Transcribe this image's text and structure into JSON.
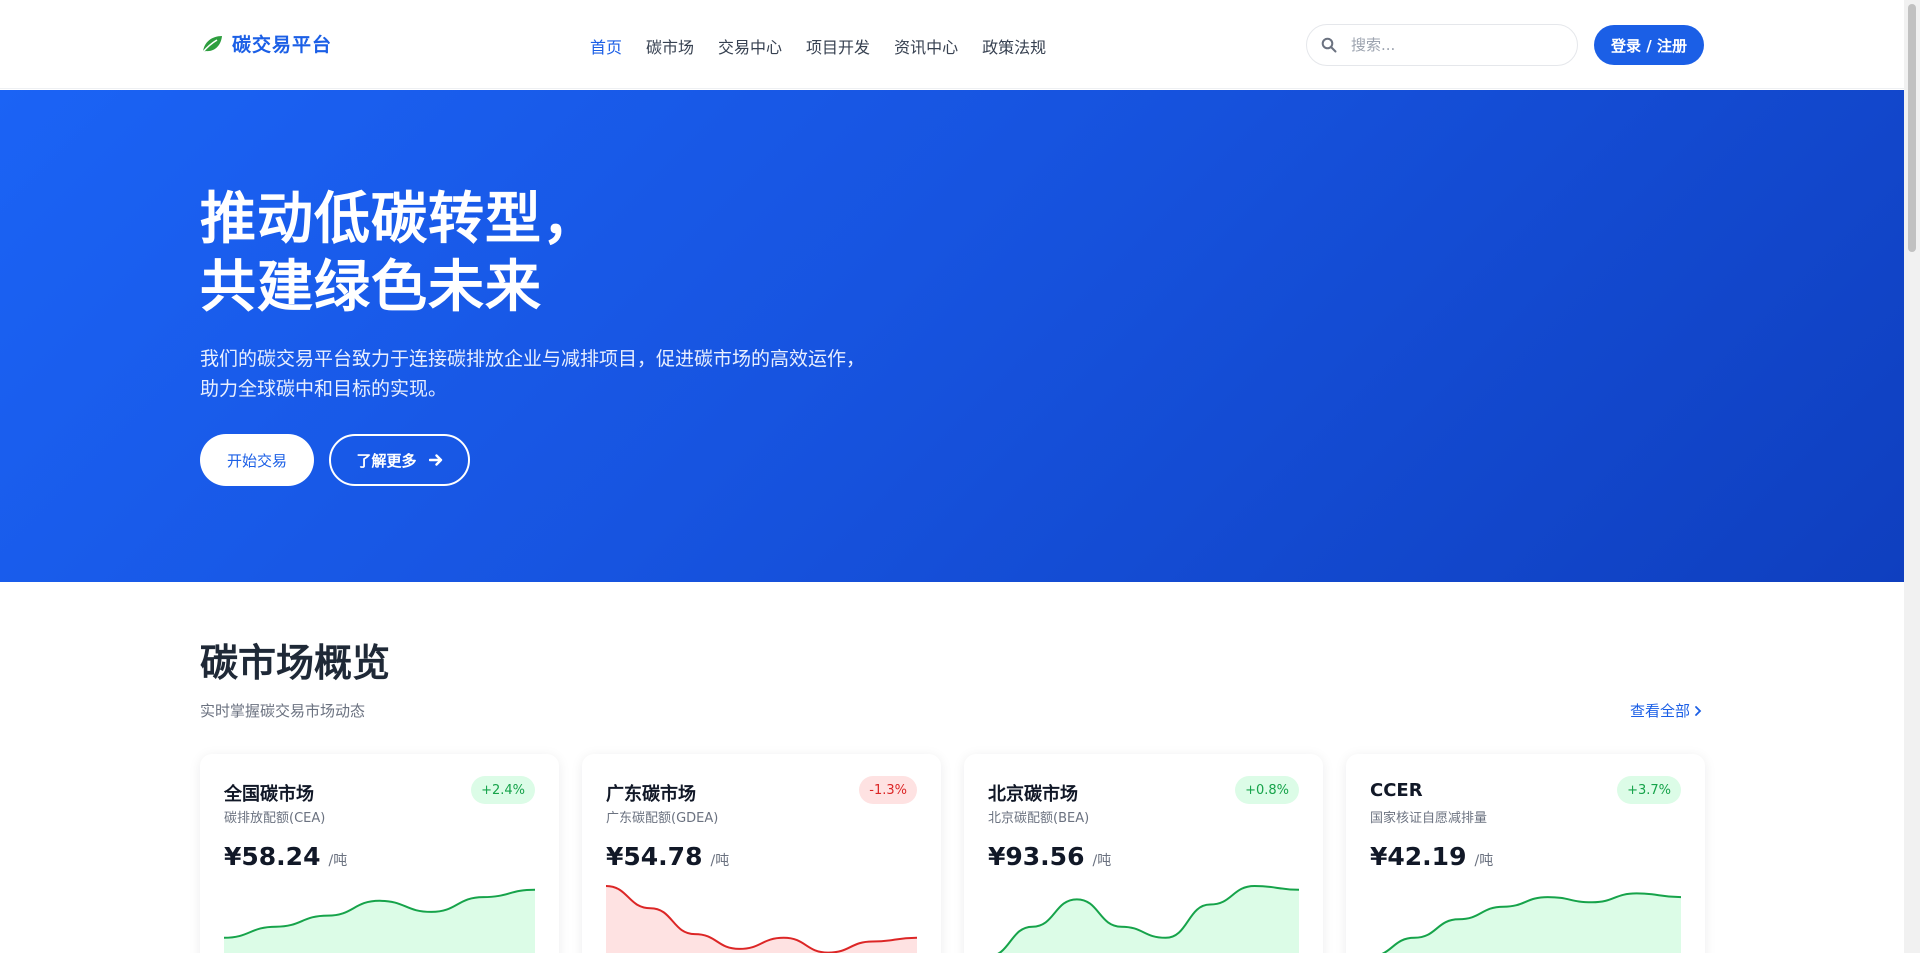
{
  "header": {
    "logo_text": "碳交易平台",
    "nav": [
      {
        "label": "首页",
        "active": true
      },
      {
        "label": "碳市场",
        "active": false
      },
      {
        "label": "交易中心",
        "active": false
      },
      {
        "label": "项目开发",
        "active": false
      },
      {
        "label": "资讯中心",
        "active": false
      },
      {
        "label": "政策法规",
        "active": false
      }
    ],
    "search_placeholder": "搜索...",
    "login_label": "登录 / 注册"
  },
  "hero": {
    "title_line1": "推动低碳转型，",
    "title_line2": "共建绿色未来",
    "subtitle": "我们的碳交易平台致力于连接碳排放企业与减排项目，促进碳市场的高效运作，助力全球碳中和目标的实现。",
    "primary_button": "开始交易",
    "secondary_button": "了解更多"
  },
  "market": {
    "title": "碳市场概览",
    "subtitle": "实时掌握碳交易市场动态",
    "view_all": "查看全部",
    "cards": [
      {
        "name": "全国碳市场",
        "desc": "碳排放配额(CEA)",
        "price": "¥58.24",
        "unit": "/吨",
        "change": "+2.4%",
        "trend": "up",
        "color": "#16a34a",
        "fill": "#dcfce7",
        "points": [
          0.3,
          0.45,
          0.6,
          0.8,
          0.65,
          0.85,
          0.95
        ]
      },
      {
        "name": "广东碳市场",
        "desc": "广东碳配额(GDEA)",
        "price": "¥54.78",
        "unit": "/吨",
        "change": "-1.3%",
        "trend": "down",
        "color": "#dc2626",
        "fill": "#fee2e2",
        "points": [
          1.0,
          0.7,
          0.35,
          0.15,
          0.3,
          0.1,
          0.25,
          0.3
        ]
      },
      {
        "name": "北京碳市场",
        "desc": "北京碳配额(BEA)",
        "price": "¥93.56",
        "unit": "/吨",
        "change": "+0.8%",
        "trend": "up",
        "color": "#16a34a",
        "fill": "#dcfce7",
        "points": [
          0.05,
          0.45,
          0.82,
          0.45,
          0.3,
          0.75,
          1.0,
          0.95
        ]
      },
      {
        "name": "CCER",
        "desc": "国家核证自愿减排量",
        "price": "¥42.19",
        "unit": "/吨",
        "change": "+3.7%",
        "trend": "up",
        "color": "#16a34a",
        "fill": "#dcfce7",
        "points": [
          0.05,
          0.3,
          0.55,
          0.72,
          0.85,
          0.78,
          0.9,
          0.85
        ]
      }
    ]
  },
  "icons": {
    "logo": "leaf-icon",
    "search": "search-icon",
    "arrow": "arrow-right-icon",
    "chevron": "chevron-right-icon"
  }
}
